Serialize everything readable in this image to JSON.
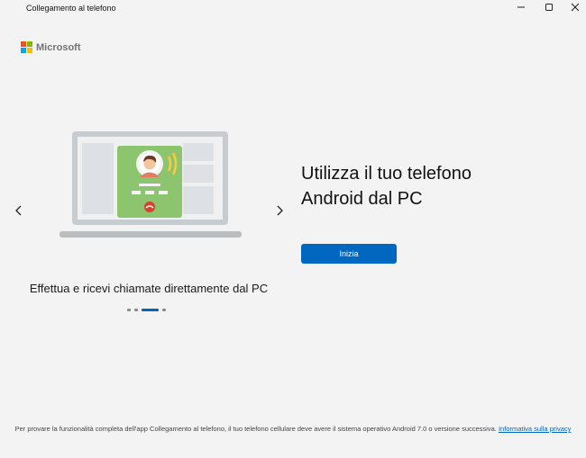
{
  "window": {
    "title": "Collegamento al telefono",
    "controls": [
      "minimize-icon",
      "maximize-icon",
      "close-icon"
    ]
  },
  "brand": {
    "name": "Microsoft",
    "colors": [
      "#f25022",
      "#7fba00",
      "#00a4ef",
      "#ffb900"
    ]
  },
  "carousel": {
    "caption": "Effettua e ricevi chiamate direttamente dal PC",
    "slide_count": 4,
    "active_index": 2,
    "prev_icon": "chevron-left-icon",
    "next_icon": "chevron-right-icon"
  },
  "hero": {
    "line1": "Utilizza il tuo telefono",
    "line2": "Android dal PC",
    "start_label": "Inizia"
  },
  "footer": {
    "text": "Per provare la funzionalità completa dell'app Collegamento al telefono, il tuo telefono cellulare deve avere il sistema operativo Android 7.0 o versione successiva.",
    "link_label": "Informativa sulla privacy"
  },
  "colors": {
    "accent": "#0067c0",
    "background": "#f3f3f3",
    "call_card": "#8cc56d",
    "hangup": "#d9412b"
  }
}
